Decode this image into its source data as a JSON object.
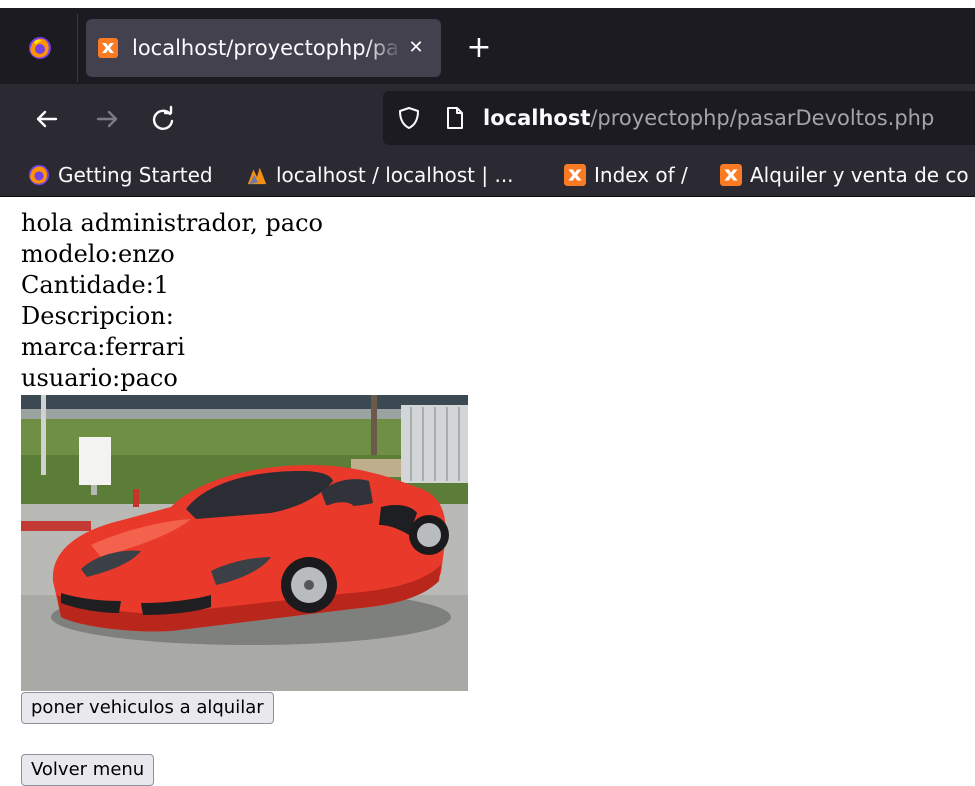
{
  "browser": {
    "tab": {
      "title": "localhost/proyectophp/pasarDevoltos.php",
      "close_icon": "close-icon",
      "favicon": "xampp-icon"
    },
    "new_tab_icon": "plus-icon",
    "nav": {
      "back_icon": "arrow-left-icon",
      "forward_icon": "arrow-right-icon",
      "reload_icon": "reload-icon"
    },
    "url": {
      "host": "localhost",
      "path": "/proyectophp/pasarDevoltos.php"
    },
    "bookmarks": [
      {
        "label": "Getting Started",
        "icon": "firefox-icon"
      },
      {
        "label": "localhost / localhost | ...",
        "icon": "phpmyadmin-icon"
      },
      {
        "label": "Index of /",
        "icon": "xampp-icon"
      },
      {
        "label": "Alquiler y venta de co",
        "icon": "xampp-icon"
      }
    ]
  },
  "page": {
    "greeting": "hola administrador, paco",
    "modelo": "modelo:enzo",
    "cantidade": "Cantidade:1",
    "descripcion": "Descripcion:",
    "marca": "marca:ferrari",
    "usuario": "usuario:paco",
    "image_subject": "red Ferrari Enzo car",
    "buttons": {
      "alquilar": "poner vehiculos a alquilar",
      "volver": "Volver menu"
    }
  },
  "colors": {
    "tabbar_bg": "#1c1b22",
    "toolbar_bg": "#2b2a33",
    "active_tab_bg": "#42414d",
    "xampp_orange": "#fb7a24",
    "car_red": "#e8392a"
  }
}
